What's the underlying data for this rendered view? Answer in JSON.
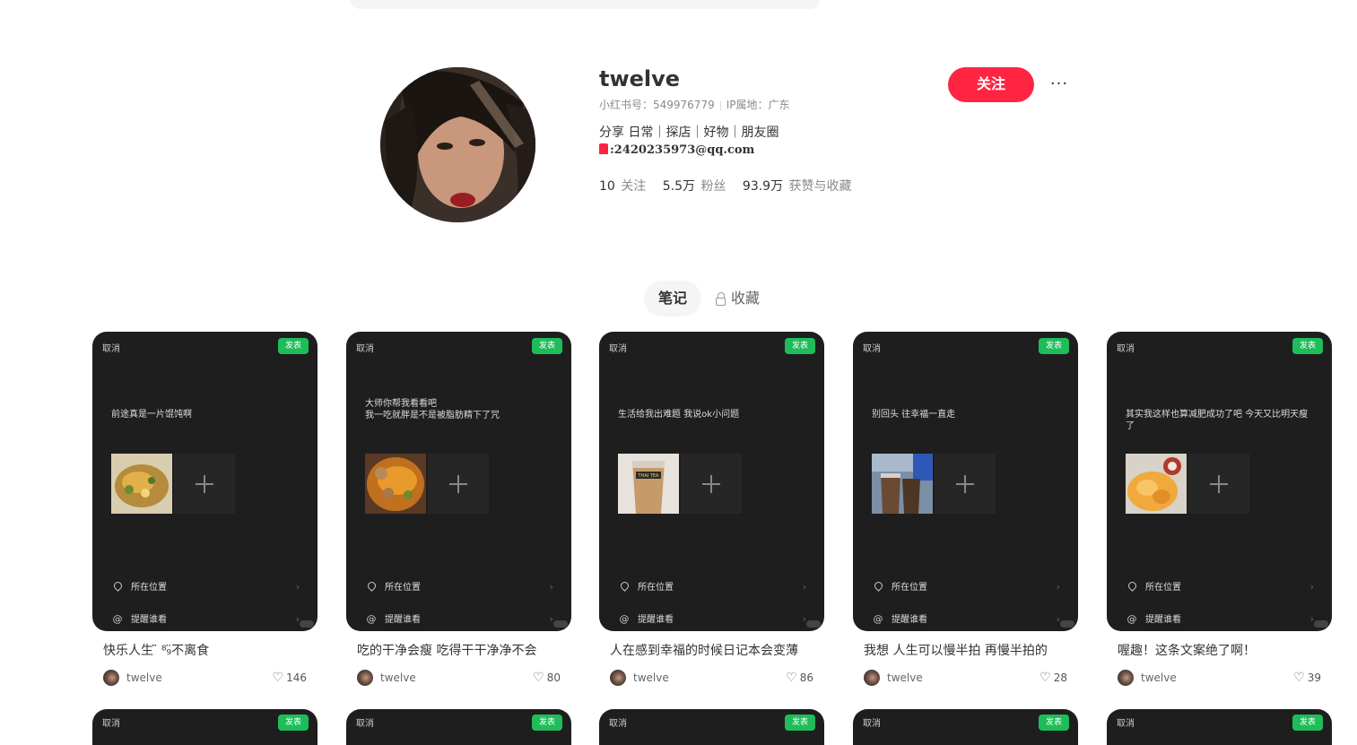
{
  "profile": {
    "username": "twelve",
    "red_id": "小红书号：549976779",
    "ip_location": "IP属地：广东",
    "bio": "分享 日常｜探店｜好物｜朋友圈",
    "email": ":2420235973@qq.com",
    "follow_label": "关注",
    "more_label": "···",
    "stats": {
      "following_count": "10",
      "following_label": "关注",
      "fans_count": "5.5万",
      "fans_label": "粉丝",
      "likes_count": "93.9万",
      "likes_label": "获赞与收藏"
    }
  },
  "tabs": [
    {
      "label": "笔记",
      "active": true
    },
    {
      "label": "收藏",
      "active": false,
      "icon": "lock-icon"
    }
  ],
  "cover_ui": {
    "cancel": "取消",
    "publish": "发表",
    "location": "所在位置",
    "mention": "提醒谁看"
  },
  "notes": [
    {
      "caption": "前途真是一片馄饨啊",
      "title": "快乐人生 ̈̈̈ ⁸₉̈不离食",
      "author": "twelve",
      "likes": "146"
    },
    {
      "caption": "大师你帮我看看吧\n我一吃就胖是不是被脂肪精下了咒",
      "title": "吃的干净会瘦 吃得干干净净不会",
      "author": "twelve",
      "likes": "80"
    },
    {
      "caption": "生活给我出难题 我说ok小问题",
      "title": "人在感到幸福的时候日记本会变薄",
      "author": "twelve",
      "likes": "86"
    },
    {
      "caption": "别回头 往幸福一直走",
      "title": "我想 人生可以慢半拍 再慢半拍的",
      "author": "twelve",
      "likes": "28"
    },
    {
      "caption": "其实我这样也算减肥成功了吧 今天又比明天瘦了",
      "title": "喔趣！这条文案绝了啊！",
      "author": "twelve",
      "likes": "39"
    }
  ],
  "colors": {
    "accent": "#ff2442",
    "publish_green": "#1fbc5a",
    "cover_bg": "#1e1e1e"
  }
}
